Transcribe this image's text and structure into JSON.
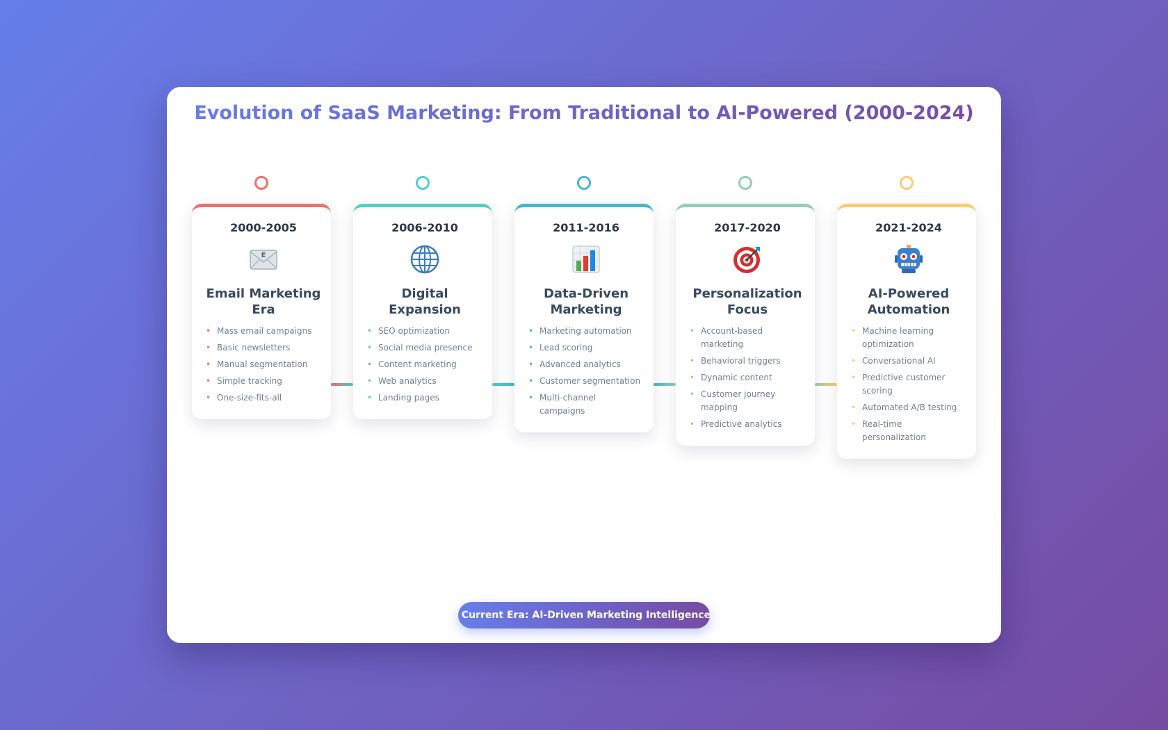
{
  "title": "Evolution of SaaS Marketing: From Traditional to AI-Powered (2000-2024)",
  "eras": [
    {
      "period": "2000-2005",
      "name": "Email Marketing Era",
      "icon": "envelope-icon",
      "color": "#ef6f6c",
      "items": [
        "Mass email campaigns",
        "Basic newsletters",
        "Manual segmentation",
        "Simple tracking",
        "One-size-fits-all"
      ]
    },
    {
      "period": "2006-2010",
      "name": "Digital Expansion",
      "icon": "globe-icon",
      "color": "#4fd1c5",
      "items": [
        "SEO optimization",
        "Social media presence",
        "Content marketing",
        "Web analytics",
        "Landing pages"
      ]
    },
    {
      "period": "2011-2016",
      "name": "Data-Driven Marketing",
      "icon": "bar-chart-icon",
      "color": "#45b7d1",
      "items": [
        "Marketing automation",
        "Lead scoring",
        "Advanced analytics",
        "Customer segmentation",
        "Multi-channel campaigns"
      ]
    },
    {
      "period": "2017-2020",
      "name": "Personalization Focus",
      "icon": "target-icon",
      "color": "#96ceb4",
      "items": [
        "Account-based marketing",
        "Behavioral triggers",
        "Dynamic content",
        "Customer journey mapping",
        "Predictive analytics"
      ]
    },
    {
      "period": "2021-2024",
      "name": "AI-Powered Automation",
      "icon": "robot-icon",
      "color": "#fdcb6e",
      "items": [
        "Machine learning optimization",
        "Conversational AI",
        "Predictive customer scoring",
        "Automated A/B testing",
        "Real-time personalization"
      ]
    }
  ],
  "footer": {
    "icon": "rocket-icon",
    "label": "Current Era: AI-Driven Marketing Intelligence"
  }
}
